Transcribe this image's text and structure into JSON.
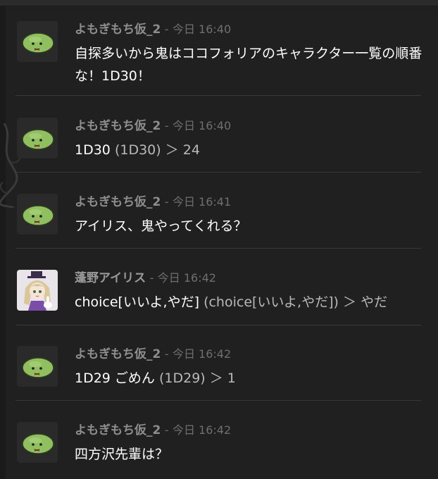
{
  "colors": {
    "background": "#202020",
    "username": "#8e8e8e",
    "timestamp": "#6f6f6f",
    "message_text": "#ffffff",
    "dice_echo": "#b9b9b9",
    "blob_avatar": "#8fbf5f"
  },
  "messages": [
    {
      "avatar_icon": "green-blob-avatar-icon",
      "name": "よもぎもち仮_2",
      "sep": "-",
      "time": "今日 16:40",
      "text": "自探多いから鬼はココフォリアのキャラクター一覧の順番な！1D30！"
    },
    {
      "avatar_icon": "green-blob-avatar-icon",
      "name": "よもぎもち仮_2",
      "sep": "-",
      "time": "今日 16:40",
      "text_main": "1D30",
      "text_echo": "(1D30) ＞ 24"
    },
    {
      "avatar_icon": "green-blob-avatar-icon",
      "name": "よもぎもち仮_2",
      "sep": "-",
      "time": "今日 16:41",
      "text": "アイリス、鬼やってくれる？"
    },
    {
      "avatar_icon": "anime-girl-avatar-icon",
      "name": "蓬野アイリス",
      "sep": "-",
      "time": "今日 16:42",
      "text_main": "choice[いいよ,やだ]",
      "text_echo": "(choice[いいよ,やだ]) ＞ やだ"
    },
    {
      "avatar_icon": "green-blob-avatar-icon",
      "name": "よもぎもち仮_2",
      "sep": "-",
      "time": "今日 16:42",
      "text_main": "1D29 ごめん",
      "text_echo": "(1D29) ＞ 1"
    },
    {
      "avatar_icon": "green-blob-avatar-icon",
      "name": "よもぎもち仮_2",
      "sep": "-",
      "time": "今日 16:42",
      "text": "四方沢先輩は？"
    }
  ]
}
